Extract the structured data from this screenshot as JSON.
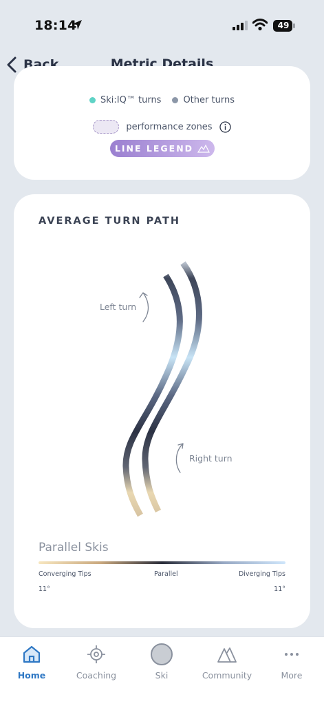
{
  "status_bar": {
    "time": "18:14",
    "battery": "49"
  },
  "nav": {
    "back_label": "Back",
    "title": "Metric Details"
  },
  "legend": {
    "skiiq_turns": "Ski:IQ™ turns",
    "other_turns": "Other turns",
    "performance_zones": "performance zones",
    "line_legend": "LINE LEGEND",
    "colors": {
      "skiiq": "#5fd3c6",
      "other": "#8c97a8",
      "zone": "#a595c7"
    }
  },
  "turn_path": {
    "title": "AVERAGE TURN PATH",
    "left_turn": "Left turn",
    "right_turn": "Right turn"
  },
  "parallel": {
    "title": "Parallel Skis",
    "converging": "Converging Tips",
    "parallel": "Parallel",
    "diverging": "Diverging Tips",
    "left_value": "11°",
    "right_value": "11°"
  },
  "tabs": [
    {
      "label": "Home",
      "icon": "home-icon",
      "active": true
    },
    {
      "label": "Coaching",
      "icon": "target-icon",
      "active": false
    },
    {
      "label": "Ski",
      "icon": "circle-icon",
      "active": false
    },
    {
      "label": "Community",
      "icon": "mountains-icon",
      "active": false
    },
    {
      "label": "More",
      "icon": "more-icon",
      "active": false
    }
  ]
}
